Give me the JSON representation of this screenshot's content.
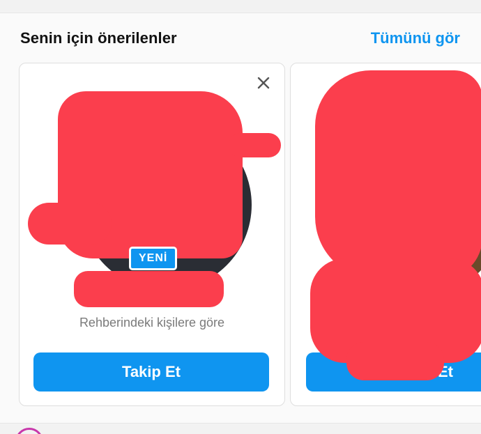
{
  "suggestions": {
    "title": "Senin için önerilenler",
    "see_all": "Tümünü gör",
    "cards": [
      {
        "badge": "YENİ",
        "reason": "Rehberindeki kişilere göre",
        "follow_label": "Takip Et"
      },
      {
        "follow_label": "Takip Et"
      }
    ]
  },
  "colors": {
    "accent": "#0f95f0",
    "redaction": "#fb3e4d"
  }
}
